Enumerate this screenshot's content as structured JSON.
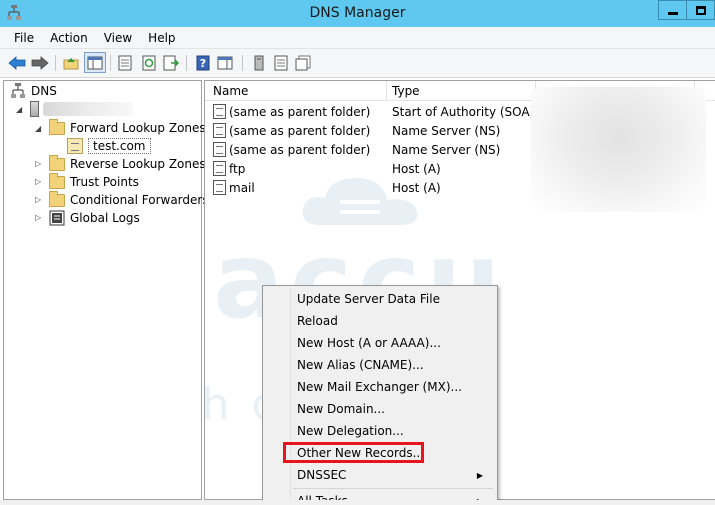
{
  "window": {
    "title": "DNS Manager",
    "icon": "dns-manager-icon",
    "controls": [
      "minimize",
      "maximize"
    ]
  },
  "menubar": {
    "items": [
      "File",
      "Action",
      "View",
      "Help"
    ]
  },
  "toolbar": {
    "buttons": [
      "back-arrow-icon",
      "forward-arrow-icon",
      "up-folder-icon",
      "show-hide-console-tree-icon",
      "properties-icon",
      "refresh-icon",
      "export-list-icon",
      "help-icon",
      "show-hide-action-pane-icon",
      "server-icon",
      "list-icon",
      "copy-icon"
    ]
  },
  "tree": {
    "root": "DNS",
    "server": "",
    "nodes": [
      {
        "label": "Forward Lookup Zones",
        "expanded": true
      },
      {
        "label": "test.com",
        "selected": true
      },
      {
        "label": "Reverse Lookup Zones",
        "expanded": false
      },
      {
        "label": "Trust Points",
        "expanded": false
      },
      {
        "label": "Conditional Forwarders",
        "expanded": false
      },
      {
        "label": "Global Logs",
        "expanded": false
      }
    ]
  },
  "list": {
    "columns": [
      "Name",
      "Type"
    ],
    "rows": [
      {
        "name": "(same as parent folder)",
        "type": "Start of Authority (SOA)"
      },
      {
        "name": "(same as parent folder)",
        "type": "Name Server (NS)"
      },
      {
        "name": "(same as parent folder)",
        "type": "Name Server (NS)"
      },
      {
        "name": "ftp",
        "type": "Host (A)"
      },
      {
        "name": "mail",
        "type": "Host (A)"
      }
    ]
  },
  "watermark": {
    "brand": "accu",
    "sub": "web hosting"
  },
  "context_menu": {
    "items": [
      {
        "label": "Update Server Data File"
      },
      {
        "label": "Reload"
      },
      {
        "label": "New Host (A or AAAA)..."
      },
      {
        "label": "New Alias (CNAME)..."
      },
      {
        "label": "New Mail Exchanger (MX)..."
      },
      {
        "label": "New Domain..."
      },
      {
        "label": "New Delegation..."
      },
      {
        "label": "Other New Records...",
        "highlighted": true
      },
      {
        "label": "DNSSEC",
        "submenu": true
      },
      {
        "label": "All Tasks",
        "submenu": true
      }
    ],
    "highlight_color": "#e8141d"
  },
  "colors": {
    "titlebar": "#5ec8f0",
    "folder": "#f2d37a"
  }
}
